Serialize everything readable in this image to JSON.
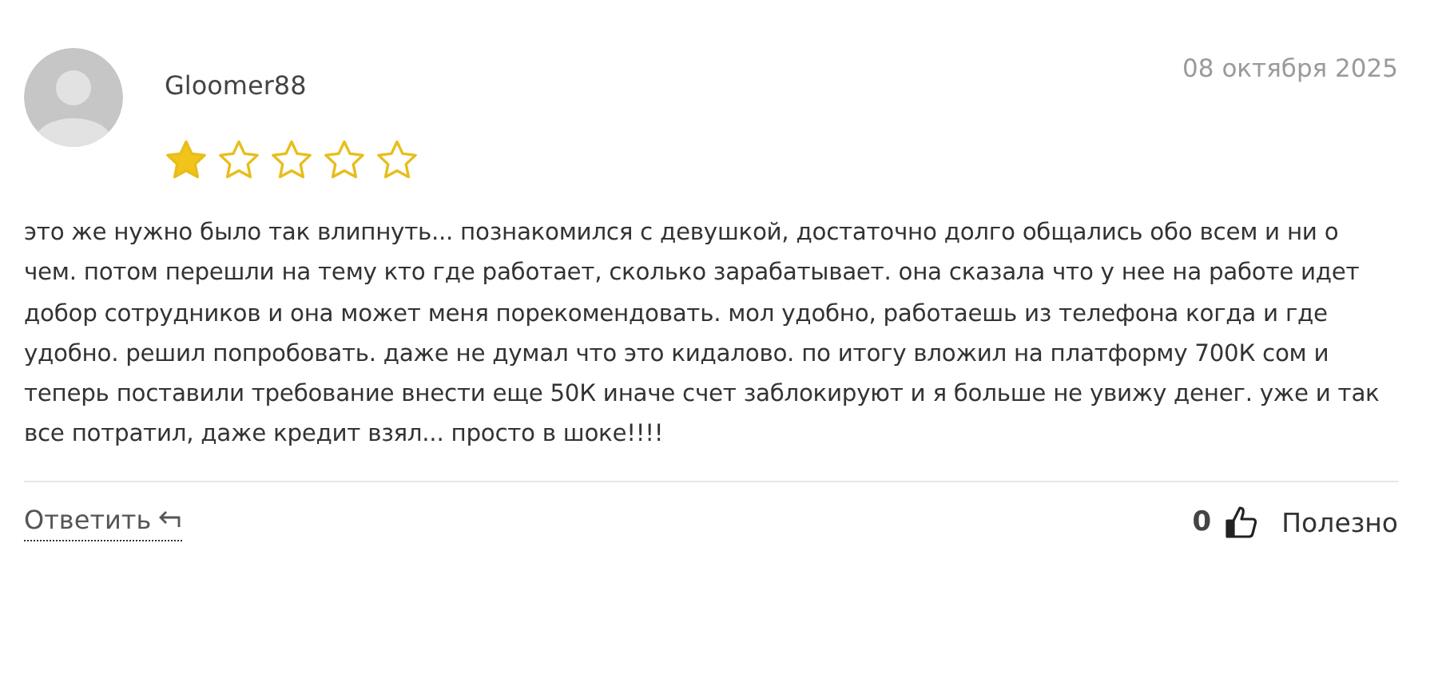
{
  "review": {
    "author": "Gloomer88",
    "date": "08 октября 2025",
    "stars": 1,
    "text": "это же нужно было так влипнуть... познакомился с девушкой, достаточно долго общались обо всем и ни о чем. потом перешли на тему кто где работает, сколько зарабатывает. она сказала что у нее на работе идет добор сотрудников и она может меня порекомендовать. мол удобно, работаешь из телефона когда и где удобно. решил попробовать. даже не думал что это кидалово. по итогу вложил на платформу 700К сом и теперь поставили требование внести еще 50К иначе счет заблокируют и я больше не увижу денег. уже и так все потратил, даже кредит взял... просто в шоке!!!!",
    "reply_link": "Ответить",
    "helpful_count": "0",
    "helpful_label": "Полезно"
  }
}
